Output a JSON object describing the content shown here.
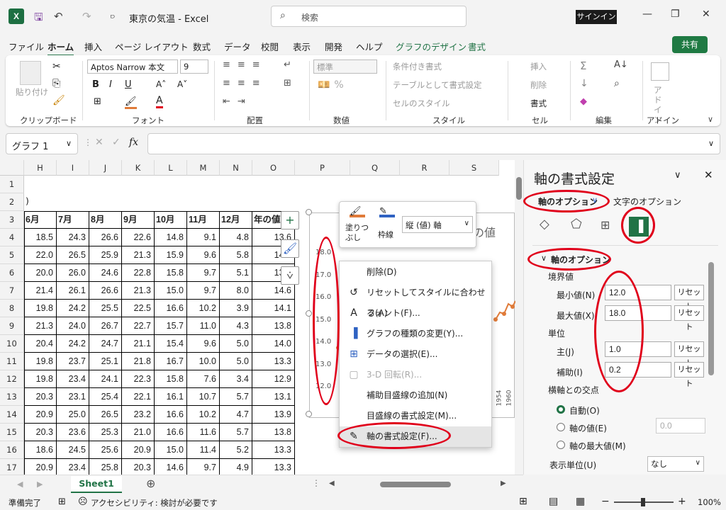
{
  "titlebar": {
    "logo": "X",
    "doc_title": "東京の気温  -  Excel",
    "search_placeholder": "検索",
    "signin_label": "サインイン"
  },
  "menu": {
    "items": [
      "ファイル",
      "ホーム",
      "挿入",
      "ページ レイアウト",
      "数式",
      "データ",
      "校閲",
      "表示",
      "開発",
      "ヘルプ",
      "グラフのデザイン",
      "書式"
    ],
    "active": "ホーム",
    "share_label": "共有"
  },
  "ribbon": {
    "paste_label": "貼り付け",
    "font_name": "Aptos Narrow 本文",
    "font_size": "9",
    "number_format": "標準",
    "cond_format": "条件付き書式",
    "table_format": "テーブルとして書式設定",
    "cell_style": "セルのスタイル",
    "insert_label": "挿入",
    "delete_label": "削除",
    "format_label": "書式",
    "addin_label": "アド イン",
    "group_labels": [
      "クリップボード",
      "フォント",
      "配置",
      "数値",
      "スタイル",
      "セル",
      "編集",
      "アドイン"
    ]
  },
  "formula_bar": {
    "name_box": "グラフ 1",
    "fx": "fx",
    "value": ""
  },
  "sheet": {
    "columns": [
      "H",
      "I",
      "J",
      "K",
      "L",
      "M",
      "N",
      "O",
      "P",
      "Q",
      "R",
      "S"
    ],
    "rows": [
      "1",
      "2",
      "3",
      "4",
      "5",
      "6",
      "7",
      "8",
      "9",
      "10",
      "11",
      "12",
      "13",
      "14",
      "15",
      "16",
      "17"
    ],
    "row2_fragment": ")",
    "headers": [
      "6月",
      "7月",
      "8月",
      "9月",
      "10月",
      "11月",
      "12月",
      "年の値"
    ],
    "data": [
      [
        "18.5",
        "24.3",
        "26.6",
        "22.6",
        "14.8",
        "9.1",
        "4.8",
        "13.6"
      ],
      [
        "22.0",
        "26.5",
        "25.9",
        "21.3",
        "15.9",
        "9.6",
        "5.8",
        "14.2"
      ],
      [
        "20.0",
        "26.0",
        "24.6",
        "22.8",
        "15.8",
        "9.7",
        "5.1",
        "13.9"
      ],
      [
        "21.4",
        "26.1",
        "26.6",
        "21.3",
        "15.0",
        "9.7",
        "8.0",
        "14.6"
      ],
      [
        "19.8",
        "24.2",
        "25.5",
        "22.5",
        "16.6",
        "10.2",
        "3.9",
        "14.1"
      ],
      [
        "21.3",
        "24.0",
        "26.7",
        "22.7",
        "15.7",
        "11.0",
        "4.3",
        "13.8"
      ],
      [
        "20.4",
        "24.2",
        "24.7",
        "21.1",
        "15.4",
        "9.6",
        "5.0",
        "14.0"
      ],
      [
        "19.8",
        "23.7",
        "25.1",
        "21.8",
        "16.7",
        "10.0",
        "5.0",
        "13.3"
      ],
      [
        "19.8",
        "23.4",
        "24.1",
        "22.3",
        "15.8",
        "7.6",
        "3.4",
        "12.9"
      ],
      [
        "20.3",
        "23.1",
        "25.4",
        "22.1",
        "16.1",
        "10.7",
        "5.7",
        "13.1"
      ],
      [
        "20.9",
        "25.0",
        "26.5",
        "23.2",
        "16.6",
        "10.2",
        "4.7",
        "13.9"
      ],
      [
        "20.3",
        "23.6",
        "25.3",
        "21.0",
        "16.6",
        "11.6",
        "5.7",
        "13.8"
      ],
      [
        "18.6",
        "24.5",
        "25.6",
        "20.9",
        "15.0",
        "11.4",
        "5.2",
        "13.3"
      ],
      [
        "20.9",
        "23.4",
        "25.8",
        "20.3",
        "14.6",
        "9.7",
        "4.9",
        "13.3"
      ]
    ],
    "tab_name": "Sheet1"
  },
  "chart": {
    "title_fragment": "の値",
    "y_ticks": [
      "18.0",
      "17.0",
      "16.0",
      "15.0",
      "14.0",
      "13.0",
      "12.0"
    ],
    "x_fragments": [
      "1954",
      "1960"
    ]
  },
  "mini_toolbar": {
    "fill_label": "塗りつぶし",
    "outline_label": "枠線",
    "element_select": "縦 (値) 軸"
  },
  "context_menu": [
    {
      "label": "削除(D)",
      "icon": "",
      "enabled": true
    },
    {
      "label": "リセットしてスタイルに合わせる(A)",
      "icon": "reset-icon",
      "enabled": true
    },
    {
      "label": "フォント(F)...",
      "icon": "font-icon",
      "enabled": true
    },
    {
      "label": "グラフの種類の変更(Y)...",
      "icon": "chart-type-icon",
      "enabled": true
    },
    {
      "label": "データの選択(E)...",
      "icon": "data-select-icon",
      "enabled": true
    },
    {
      "label": "3-D 回転(R)...",
      "icon": "rotate-3d-icon",
      "enabled": false
    },
    {
      "label": "補助目盛線の追加(N)",
      "icon": "",
      "enabled": true
    },
    {
      "label": "目盛線の書式設定(M)...",
      "icon": "",
      "enabled": true
    },
    {
      "label": "軸の書式設定(F)...",
      "icon": "format-axis-icon",
      "enabled": true
    }
  ],
  "pane": {
    "title": "軸の書式設定",
    "tab_axis_options": "軸のオプション",
    "tab_text_options": "文字のオプション",
    "section_title": "軸のオプション",
    "bounds_label": "境界値",
    "min_label": "最小値(N)",
    "min_value": "12.0",
    "max_label": "最大値(X)",
    "max_value": "18.0",
    "reset_label": "リセット",
    "units_label": "単位",
    "major_label": "主(J)",
    "major_value": "1.0",
    "minor_label": "補助(I)",
    "minor_value": "0.2",
    "cross_label": "横軸との交点",
    "auto_label": "自動(O)",
    "axis_value_label": "軸の値(E)",
    "axis_value": "0.0",
    "axis_max_label": "軸の最大値(M)",
    "display_units_label": "表示単位(U)",
    "display_units_value": "なし"
  },
  "statusbar": {
    "ready": "準備完了",
    "accessibility": "アクセシビリティ: 検討が必要です",
    "zoom": "100%"
  },
  "colors": {
    "excel_green": "#217346",
    "highlight_red": "#e0001b",
    "series_orange": "#e07b39"
  }
}
